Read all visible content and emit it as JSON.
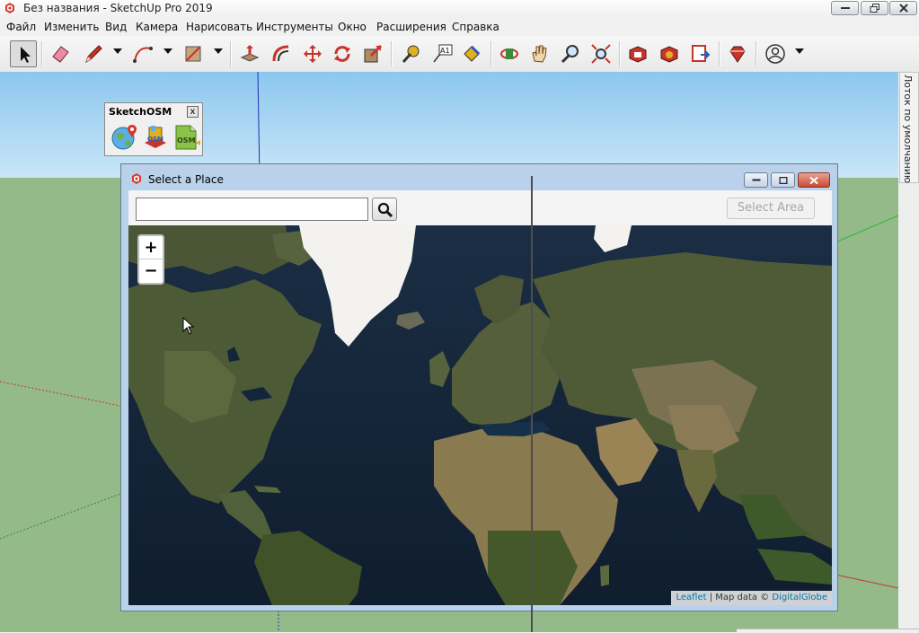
{
  "window": {
    "title": "Без названия - SketchUp Pro 2019",
    "app_icon": "sketchup-logo-icon",
    "buttons": [
      "minimize-icon",
      "restore-icon",
      "close-icon"
    ]
  },
  "menu": [
    "Файл",
    "Изменить",
    "Вид",
    "Камера",
    "Нарисовать",
    "Инструменты",
    "Окно",
    "Расширения",
    "Справка"
  ],
  "toolbar": {
    "tools": [
      "select-arrow-icon",
      "eraser-icon",
      "pencil-line-icon",
      "arc-icon",
      "rectangle-icon",
      "push-pull-icon",
      "offset-icon",
      "move-icon",
      "rotate-icon",
      "scale-icon",
      "tape-measure-icon",
      "text-icon",
      "paint-bucket-icon",
      "orbit-icon",
      "pan-hand-icon",
      "zoom-icon",
      "zoom-extents-icon",
      "3d-warehouse-icon",
      "extension-warehouse-icon",
      "layout-send-icon",
      "ruby-icon",
      "account-icon"
    ],
    "text_tool_label": "A1"
  },
  "tray": {
    "label": "Лоток по умолчанию"
  },
  "sketchosm": {
    "title": "SketchOSM",
    "close": "x",
    "icons": [
      "globe-pin-icon",
      "osm-import-icon",
      "osm-file-icon"
    ],
    "osm_badge": "OSM"
  },
  "dialog": {
    "title": "Select a Place",
    "search": {
      "value": "",
      "placeholder": ""
    },
    "select_area_label": "Select Area",
    "zoom_in": "+",
    "zoom_out": "−",
    "attribution": {
      "leaflet": "Leaflet",
      "sep": " | Map data © ",
      "provider": "DigitalGlobe"
    }
  },
  "colors": {
    "sky_top": "#8cc7ee",
    "ground": "#94ba8a",
    "dialog_frame": "#b9d1ea",
    "map_ocean": "#13253a",
    "map_land": "#4b5a35",
    "map_ice": "#f3f2ef",
    "disabled_text": "#a8a8a8",
    "link": "#0078a8"
  }
}
